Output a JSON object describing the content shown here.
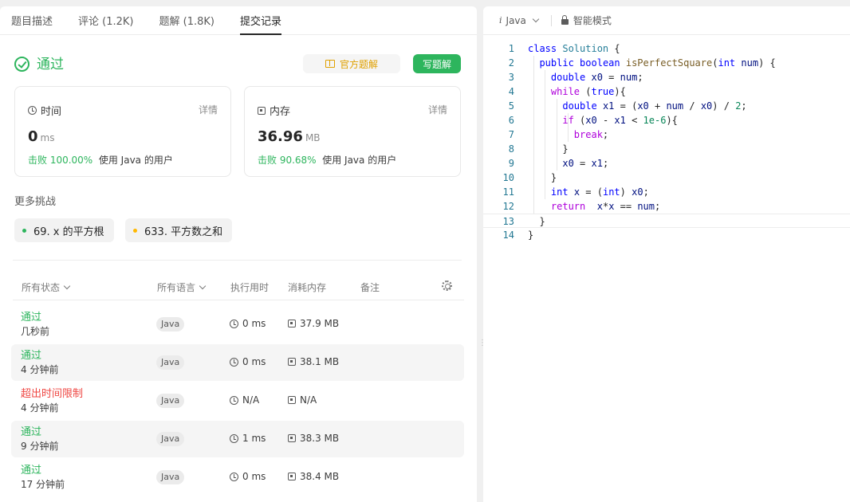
{
  "left": {
    "tabs": [
      {
        "label": "题目描述"
      },
      {
        "label": "评论 (1.2K)"
      },
      {
        "label": "题解 (1.8K)"
      },
      {
        "label": "提交记录",
        "active": true
      }
    ],
    "status_title": "通过",
    "official_solution_label": "官方题解",
    "write_solution_label": "写题解",
    "runtime_card": {
      "title": "时间",
      "detail": "详情",
      "value": "0",
      "unit": "ms",
      "beat_pct": "击败 100.00%",
      "beat_text": "使用 Java 的用户"
    },
    "memory_card": {
      "title": "内存",
      "detail": "详情",
      "value": "36.96",
      "unit": "MB",
      "beat_pct": "击败 90.68%",
      "beat_text": "使用 Java 的用户"
    },
    "more_challenges_title": "更多挑战",
    "challenges": [
      {
        "label": "69. x 的平方根",
        "dot_color": "#2db55d"
      },
      {
        "label": "633. 平方数之和",
        "dot_color": "#ffb800"
      }
    ],
    "table": {
      "headers": {
        "status": "所有状态",
        "language": "所有语言",
        "runtime": "执行用时",
        "memory": "消耗内存",
        "note": "备注"
      },
      "rows": [
        {
          "status": "通过",
          "ok": true,
          "time": "几秒前",
          "lang": "Java",
          "runtime": "0 ms",
          "memory": "37.9 MB"
        },
        {
          "status": "通过",
          "ok": true,
          "time": "4 分钟前",
          "lang": "Java",
          "runtime": "0 ms",
          "memory": "38.1 MB"
        },
        {
          "status": "超出时间限制",
          "ok": false,
          "time": "4 分钟前",
          "lang": "Java",
          "runtime": "N/A",
          "memory": "N/A"
        },
        {
          "status": "通过",
          "ok": true,
          "time": "9 分钟前",
          "lang": "Java",
          "runtime": "1 ms",
          "memory": "38.3 MB"
        },
        {
          "status": "通过",
          "ok": true,
          "time": "17 分钟前",
          "lang": "Java",
          "runtime": "0 ms",
          "memory": "38.4 MB"
        }
      ]
    }
  },
  "editor": {
    "language": "Java",
    "mode_label": "智能模式",
    "line_numbers": [
      "1",
      "2",
      "3",
      "4",
      "5",
      "6",
      "7",
      "8",
      "9",
      "10",
      "11",
      "12",
      "13",
      "14"
    ],
    "colors": {
      "keyword": "#0000ff",
      "type": "#267f99",
      "function": "#795e26",
      "param": "#001080",
      "number": "#098658",
      "control": "#af00db"
    },
    "lines": [
      [
        [
          "kw",
          "class"
        ],
        [
          "tx",
          " "
        ],
        [
          "ty",
          "Solution"
        ],
        [
          "tx",
          " {"
        ]
      ],
      [
        [
          "tx",
          "  "
        ],
        [
          "kw",
          "public"
        ],
        [
          "tx",
          " "
        ],
        [
          "kw",
          "boolean"
        ],
        [
          "tx",
          " "
        ],
        [
          "fn",
          "isPerfectSquare"
        ],
        [
          "tx",
          "("
        ],
        [
          "kw",
          "int"
        ],
        [
          "tx",
          " "
        ],
        [
          "pm",
          "num"
        ],
        [
          "tx",
          ") {"
        ]
      ],
      [
        [
          "tx",
          "    "
        ],
        [
          "kw",
          "double"
        ],
        [
          "tx",
          " "
        ],
        [
          "pm",
          "x0"
        ],
        [
          "tx",
          " = "
        ],
        [
          "pm",
          "num"
        ],
        [
          "tx",
          ";"
        ]
      ],
      [
        [
          "tx",
          "    "
        ],
        [
          "ctl",
          "while"
        ],
        [
          "tx",
          " ("
        ],
        [
          "kw",
          "true"
        ],
        [
          "tx",
          "){"
        ]
      ],
      [
        [
          "tx",
          "      "
        ],
        [
          "kw",
          "double"
        ],
        [
          "tx",
          " "
        ],
        [
          "pm",
          "x1"
        ],
        [
          "tx",
          " = ("
        ],
        [
          "pm",
          "x0"
        ],
        [
          "tx",
          " + "
        ],
        [
          "pm",
          "num"
        ],
        [
          "tx",
          " / "
        ],
        [
          "pm",
          "x0"
        ],
        [
          "tx",
          ") / "
        ],
        [
          "nu",
          "2"
        ],
        [
          "tx",
          ";"
        ]
      ],
      [
        [
          "tx",
          "      "
        ],
        [
          "ctl",
          "if"
        ],
        [
          "tx",
          " ("
        ],
        [
          "pm",
          "x0"
        ],
        [
          "tx",
          " - "
        ],
        [
          "pm",
          "x1"
        ],
        [
          "tx",
          " < "
        ],
        [
          "nu",
          "1e-6"
        ],
        [
          "tx",
          "){"
        ]
      ],
      [
        [
          "tx",
          "        "
        ],
        [
          "ctl",
          "break"
        ],
        [
          "tx",
          ";"
        ]
      ],
      [
        [
          "tx",
          "      }"
        ]
      ],
      [
        [
          "tx",
          "      "
        ],
        [
          "pm",
          "x0"
        ],
        [
          "tx",
          " = "
        ],
        [
          "pm",
          "x1"
        ],
        [
          "tx",
          ";"
        ]
      ],
      [
        [
          "tx",
          "    }"
        ]
      ],
      [
        [
          "tx",
          "    "
        ],
        [
          "kw",
          "int"
        ],
        [
          "tx",
          " "
        ],
        [
          "pm",
          "x"
        ],
        [
          "tx",
          " = ("
        ],
        [
          "kw",
          "int"
        ],
        [
          "tx",
          ") "
        ],
        [
          "pm",
          "x0"
        ],
        [
          "tx",
          ";"
        ]
      ],
      [
        [
          "tx",
          "    "
        ],
        [
          "ctl",
          "return"
        ],
        [
          "tx",
          "  "
        ],
        [
          "pm",
          "x"
        ],
        [
          "tx",
          "*"
        ],
        [
          "pm",
          "x"
        ],
        [
          "tx",
          " == "
        ],
        [
          "pm",
          "num"
        ],
        [
          "tx",
          ";"
        ]
      ],
      [
        [
          "tx",
          "  }"
        ]
      ],
      [
        [
          "tx",
          "}"
        ]
      ]
    ]
  }
}
